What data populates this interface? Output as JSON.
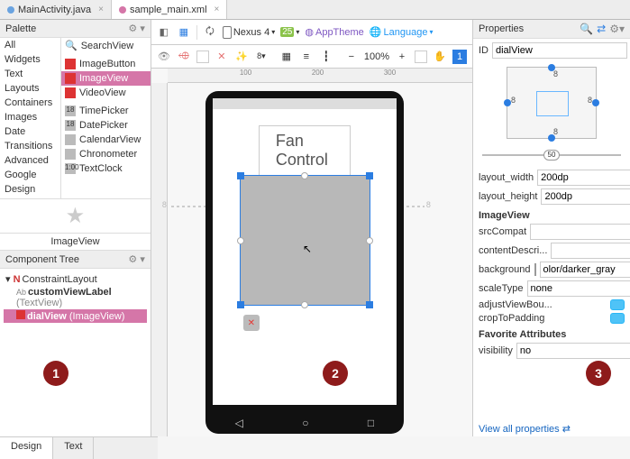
{
  "tabs": [
    {
      "label": "MainActivity.java",
      "active": false
    },
    {
      "label": "sample_main.xml",
      "active": true
    }
  ],
  "palette": {
    "title": "Palette",
    "categories": [
      "All",
      "Widgets",
      "Text",
      "Layouts",
      "Containers",
      "Images",
      "Date",
      "Transitions",
      "Advanced",
      "Google",
      "Design"
    ],
    "search": "SearchView",
    "items": [
      {
        "label": "ImageButton",
        "kind": "img"
      },
      {
        "label": "ImageView",
        "kind": "img",
        "selected": true
      },
      {
        "label": "VideoView",
        "kind": "img"
      },
      {
        "label": "TimePicker",
        "kind": "txt",
        "prefix": "18"
      },
      {
        "label": "DatePicker",
        "kind": "txt",
        "prefix": "18"
      },
      {
        "label": "CalendarView",
        "kind": "txt",
        "prefix": ""
      },
      {
        "label": "Chronometer",
        "kind": "txt",
        "prefix": ""
      },
      {
        "label": "TextClock",
        "kind": "txt",
        "prefix": "1:00"
      }
    ],
    "selected_label": "ImageView"
  },
  "component_tree": {
    "title": "Component Tree",
    "root": {
      "label": "ConstraintLayout"
    },
    "children": [
      {
        "label": "customViewLabel",
        "type": "(TextView)"
      },
      {
        "label": "dialView",
        "type": "(ImageView)",
        "selected": true
      }
    ]
  },
  "bottom_tabs": {
    "design": "Design",
    "text": "Text"
  },
  "toolbar": {
    "device": "Nexus 4",
    "api": "25",
    "theme": "AppTheme",
    "language": "Language",
    "zoom": "100%",
    "one": "1"
  },
  "canvas": {
    "title_text": "Fan Control",
    "constraint_margin": "8",
    "ruler_marks": [
      "100",
      "200",
      "300"
    ]
  },
  "properties": {
    "title": "Properties",
    "id_label": "ID",
    "id_value": "dialView",
    "constraint": {
      "top": "8",
      "bottom": "8",
      "left": "8",
      "right": "8"
    },
    "slider_value": "50",
    "rows": {
      "layout_width": {
        "label": "layout_width",
        "value": "200dp"
      },
      "layout_height": {
        "label": "layout_height",
        "value": "200dp"
      }
    },
    "section_imageview": "ImageView",
    "srcCompat": {
      "label": "srcCompat",
      "value": ""
    },
    "contentDesc": {
      "label": "contentDescri...",
      "value": ""
    },
    "background": {
      "label": "background",
      "value": "olor/darker_gray"
    },
    "scaleType": {
      "label": "scaleType",
      "value": "none"
    },
    "adjustViewBounds": {
      "label": "adjustViewBou..."
    },
    "cropToPadding": {
      "label": "cropToPadding"
    },
    "section_fav": "Favorite Attributes",
    "visibility": {
      "label": "visibility",
      "value": "no"
    },
    "view_all": "View all properties"
  },
  "callouts": {
    "one": "1",
    "two": "2",
    "three": "3"
  }
}
